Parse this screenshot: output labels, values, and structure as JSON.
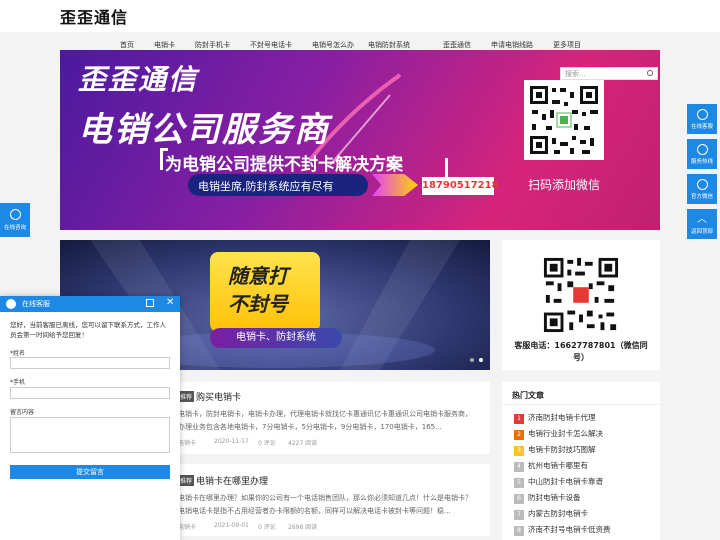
{
  "header": {
    "logo": "歪歪通信"
  },
  "nav": [
    "首页",
    "电销卡",
    "防封手机卡",
    "不封号电话卡",
    "电销号怎么办",
    "电销防封系统",
    "歪歪通信",
    "申请电销线路",
    "更多项目"
  ],
  "search": {
    "placeholder": "搜索..."
  },
  "banner1": {
    "title1": "歪歪通信",
    "title2": "电销公司服务商",
    "subtitle": "为电销公司提供不封卡解决方案",
    "pill": "电销坐席,防封系统应有尽有",
    "phone": "18790517218",
    "qr_caption": "扫码添加微信"
  },
  "banner2": {
    "line1": "随意打",
    "line2": "不封号",
    "pill": "电销卡、防封系统"
  },
  "contact_card": {
    "text": "客服电话：16627787801（微信同号）"
  },
  "hot": {
    "title": "热门文章",
    "items": [
      {
        "num": "1",
        "label": "济南防封电销卡代理",
        "color": "#e53935"
      },
      {
        "num": "2",
        "label": "电销行业封卡怎么解决",
        "color": "#ef6c00"
      },
      {
        "num": "3",
        "label": "电销卡防封技巧图解",
        "color": "#fbc02d"
      },
      {
        "num": "4",
        "label": "杭州电销卡哪里有",
        "color": "#bbb"
      },
      {
        "num": "5",
        "label": "中山防封卡电销卡靠谱",
        "color": "#bbb"
      },
      {
        "num": "6",
        "label": "防封电销卡设备",
        "color": "#bbb"
      },
      {
        "num": "7",
        "label": "内蒙古防封电销卡",
        "color": "#bbb"
      },
      {
        "num": "8",
        "label": "济南不封号电销卡低资费",
        "color": "#bbb"
      }
    ]
  },
  "posts": [
    {
      "tag": "推荐",
      "title": "购买电销卡",
      "excerpt": "电销卡，防封电销卡，电销卡办理，代理电销卡就找亿卡惠通讯亿卡惠通讯公司电销卡服务商，办理业务包含各地电销卡，7分电销卡，5分电销卡，9分电销卡，170电销卡，165...",
      "category": "电销卡",
      "date": "2020-11-17",
      "comments": "0 评论",
      "reads": "4227 阅读"
    },
    {
      "tag": "推荐",
      "title": "电销卡在哪里办理",
      "excerpt": "电销卡在哪里办理？如果你的公司有一个电话销售团队，那么你必须知道几点！什么是电销卡？电销电话卡是指不占用经营者办卡限额的名额，同样可以解决电话卡被封卡等问题！稳...",
      "category": "电销卡",
      "date": "2021-09-01",
      "comments": "0 评论",
      "reads": "2698 阅读"
    }
  ],
  "float": [
    {
      "label": "在线客服",
      "icon": "headset-icon"
    },
    {
      "label": "服务热线",
      "icon": "phone-icon"
    },
    {
      "label": "官方微信",
      "icon": "wechat-icon"
    },
    {
      "label": "返回顶部",
      "icon": "arrow-up-icon"
    }
  ],
  "left_chat": {
    "label": "在线咨询"
  },
  "chat_panel": {
    "title": "在线客服",
    "message": "您好，当前客服已离线，您可以留下联系方式，工作人员会第一时间给予您回复！",
    "name_label": "*姓名",
    "phone_label": "*手机",
    "message_label": "留言内容",
    "submit": "提交留言"
  }
}
